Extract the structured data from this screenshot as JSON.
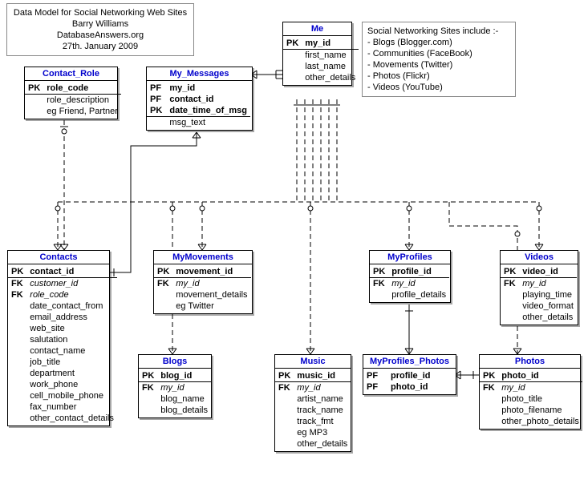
{
  "title_note": {
    "line1": "Data Model for Social Networking Web Sites",
    "line2": "Barry Williams",
    "line3": "DatabaseAnswers.org",
    "line4": "27th. January 2009"
  },
  "info_note": {
    "line1": "Social Networking Sites include :-",
    "line2": "- Blogs (Blogger.com)",
    "line3": "- Communities (FaceBook)",
    "line4": "- Movements (Twitter)",
    "line5": "- Photos (Flickr)",
    "line6": "- Videos (YouTube)"
  },
  "entities": {
    "me": {
      "title": "Me",
      "rows": [
        {
          "k": "PK",
          "a": "my_id",
          "t": "pk"
        },
        {
          "k": "",
          "a": "first_name",
          "t": ""
        },
        {
          "k": "",
          "a": "last_name",
          "t": ""
        },
        {
          "k": "",
          "a": "other_details",
          "t": ""
        }
      ]
    },
    "contact_role": {
      "title": "Contact_Role",
      "rows": [
        {
          "k": "PK",
          "a": "role_code",
          "t": "pk"
        },
        {
          "k": "",
          "a": "role_description",
          "t": ""
        },
        {
          "k": "",
          "a": "eg Friend, Partner",
          "t": ""
        }
      ]
    },
    "my_messages": {
      "title": "My_Messages",
      "rows": [
        {
          "k": "PF",
          "a": "my_id",
          "t": "pk"
        },
        {
          "k": "PF",
          "a": "contact_id",
          "t": "pk"
        },
        {
          "k": "PK",
          "a": "date_time_of_msg",
          "t": "pk"
        },
        {
          "k": "",
          "a": "msg_text",
          "t": ""
        }
      ]
    },
    "contacts": {
      "title": "Contacts",
      "rows": [
        {
          "k": "PK",
          "a": "contact_id",
          "t": "pk"
        },
        {
          "k": "FK",
          "a": "customer_id",
          "t": "fk"
        },
        {
          "k": "FK",
          "a": "role_code",
          "t": "fk"
        },
        {
          "k": "",
          "a": "date_contact_from",
          "t": ""
        },
        {
          "k": "",
          "a": "email_address",
          "t": ""
        },
        {
          "k": "",
          "a": "web_site",
          "t": ""
        },
        {
          "k": "",
          "a": "salutation",
          "t": ""
        },
        {
          "k": "",
          "a": "contact_name",
          "t": ""
        },
        {
          "k": "",
          "a": "job_title",
          "t": ""
        },
        {
          "k": "",
          "a": "department",
          "t": ""
        },
        {
          "k": "",
          "a": "work_phone",
          "t": ""
        },
        {
          "k": "",
          "a": "cell_mobile_phone",
          "t": ""
        },
        {
          "k": "",
          "a": "fax_number",
          "t": ""
        },
        {
          "k": "",
          "a": "other_contact_details",
          "t": ""
        }
      ]
    },
    "my_movements": {
      "title": "MyMovements",
      "rows": [
        {
          "k": "PK",
          "a": "movement_id",
          "t": "pk"
        },
        {
          "k": "FK",
          "a": "my_id",
          "t": "fk"
        },
        {
          "k": "",
          "a": "movement_details",
          "t": ""
        },
        {
          "k": "",
          "a": "eg Twitter",
          "t": ""
        }
      ]
    },
    "my_profiles": {
      "title": "MyProfiles",
      "rows": [
        {
          "k": "PK",
          "a": "profile_id",
          "t": "pk"
        },
        {
          "k": "FK",
          "a": "my_id",
          "t": "fk"
        },
        {
          "k": "",
          "a": "profile_details",
          "t": ""
        }
      ]
    },
    "videos": {
      "title": "Videos",
      "rows": [
        {
          "k": "PK",
          "a": "video_id",
          "t": "pk"
        },
        {
          "k": "FK",
          "a": "my_id",
          "t": "fk"
        },
        {
          "k": "",
          "a": "playing_time",
          "t": ""
        },
        {
          "k": "",
          "a": "video_format",
          "t": ""
        },
        {
          "k": "",
          "a": "other_details",
          "t": ""
        }
      ]
    },
    "blogs": {
      "title": "Blogs",
      "rows": [
        {
          "k": "PK",
          "a": "blog_id",
          "t": "pk"
        },
        {
          "k": "FK",
          "a": "my_id",
          "t": "fk"
        },
        {
          "k": "",
          "a": "blog_name",
          "t": ""
        },
        {
          "k": "",
          "a": "blog_details",
          "t": ""
        }
      ]
    },
    "music": {
      "title": "Music",
      "rows": [
        {
          "k": "PK",
          "a": "music_id",
          "t": "pk"
        },
        {
          "k": "FK",
          "a": "my_id",
          "t": "fk"
        },
        {
          "k": "",
          "a": "artist_name",
          "t": ""
        },
        {
          "k": "",
          "a": "track_name",
          "t": ""
        },
        {
          "k": "",
          "a": "track_fmt",
          "t": ""
        },
        {
          "k": "",
          "a": "eg MP3",
          "t": ""
        },
        {
          "k": "",
          "a": "other_details",
          "t": ""
        }
      ]
    },
    "my_profiles_photos": {
      "title": "MyProfiles_Photos",
      "rows": [
        {
          "k": "PF",
          "a": "profile_id",
          "t": "pk"
        },
        {
          "k": "PF",
          "a": "photo_id",
          "t": "pk"
        }
      ]
    },
    "photos": {
      "title": "Photos",
      "rows": [
        {
          "k": "PK",
          "a": "photo_id",
          "t": "pk"
        },
        {
          "k": "FK",
          "a": "my_id",
          "t": "fk"
        },
        {
          "k": "",
          "a": "photo_title",
          "t": ""
        },
        {
          "k": "",
          "a": "photo_filename",
          "t": ""
        },
        {
          "k": "",
          "a": "other_photo_details",
          "t": ""
        }
      ]
    }
  },
  "chart_data": {
    "type": "er-diagram",
    "entities": [
      {
        "name": "Me",
        "attributes": [
          "PK my_id",
          "first_name",
          "last_name",
          "other_details"
        ]
      },
      {
        "name": "Contact_Role",
        "attributes": [
          "PK role_code",
          "role_description",
          "eg Friend, Partner"
        ]
      },
      {
        "name": "My_Messages",
        "attributes": [
          "PF my_id",
          "PF contact_id",
          "PK date_time_of_msg",
          "msg_text"
        ]
      },
      {
        "name": "Contacts",
        "attributes": [
          "PK contact_id",
          "FK customer_id",
          "FK role_code",
          "date_contact_from",
          "email_address",
          "web_site",
          "salutation",
          "contact_name",
          "job_title",
          "department",
          "work_phone",
          "cell_mobile_phone",
          "fax_number",
          "other_contact_details"
        ]
      },
      {
        "name": "MyMovements",
        "attributes": [
          "PK movement_id",
          "FK my_id",
          "movement_details",
          "eg Twitter"
        ]
      },
      {
        "name": "MyProfiles",
        "attributes": [
          "PK profile_id",
          "FK my_id",
          "profile_details"
        ]
      },
      {
        "name": "Videos",
        "attributes": [
          "PK video_id",
          "FK my_id",
          "playing_time",
          "video_format",
          "other_details"
        ]
      },
      {
        "name": "Blogs",
        "attributes": [
          "PK blog_id",
          "FK my_id",
          "blog_name",
          "blog_details"
        ]
      },
      {
        "name": "Music",
        "attributes": [
          "PK music_id",
          "FK my_id",
          "artist_name",
          "track_name",
          "track_fmt",
          "eg MP3",
          "other_details"
        ]
      },
      {
        "name": "MyProfiles_Photos",
        "attributes": [
          "PF profile_id",
          "PF photo_id"
        ]
      },
      {
        "name": "Photos",
        "attributes": [
          "PK photo_id",
          "FK my_id",
          "photo_title",
          "photo_filename",
          "other_photo_details"
        ]
      }
    ],
    "relationships": [
      {
        "from": "Me",
        "to": "My_Messages",
        "type": "one-to-many",
        "identifying": true
      },
      {
        "from": "Contacts",
        "to": "My_Messages",
        "type": "one-to-many",
        "identifying": true
      },
      {
        "from": "Contact_Role",
        "to": "Contacts",
        "type": "one-to-many",
        "identifying": false
      },
      {
        "from": "Me",
        "to": "Contacts",
        "type": "one-to-many",
        "identifying": false
      },
      {
        "from": "Me",
        "to": "Blogs",
        "type": "one-to-many",
        "identifying": false
      },
      {
        "from": "Me",
        "to": "MyMovements",
        "type": "one-to-many",
        "identifying": false
      },
      {
        "from": "Me",
        "to": "Music",
        "type": "one-to-many",
        "identifying": false
      },
      {
        "from": "Me",
        "to": "MyProfiles",
        "type": "one-to-many",
        "identifying": false
      },
      {
        "from": "Me",
        "to": "Photos",
        "type": "one-to-many",
        "identifying": false
      },
      {
        "from": "Me",
        "to": "Videos",
        "type": "one-to-many",
        "identifying": false
      },
      {
        "from": "MyProfiles",
        "to": "MyProfiles_Photos",
        "type": "one-to-many",
        "identifying": true
      },
      {
        "from": "Photos",
        "to": "MyProfiles_Photos",
        "type": "one-to-many",
        "identifying": true
      }
    ]
  }
}
